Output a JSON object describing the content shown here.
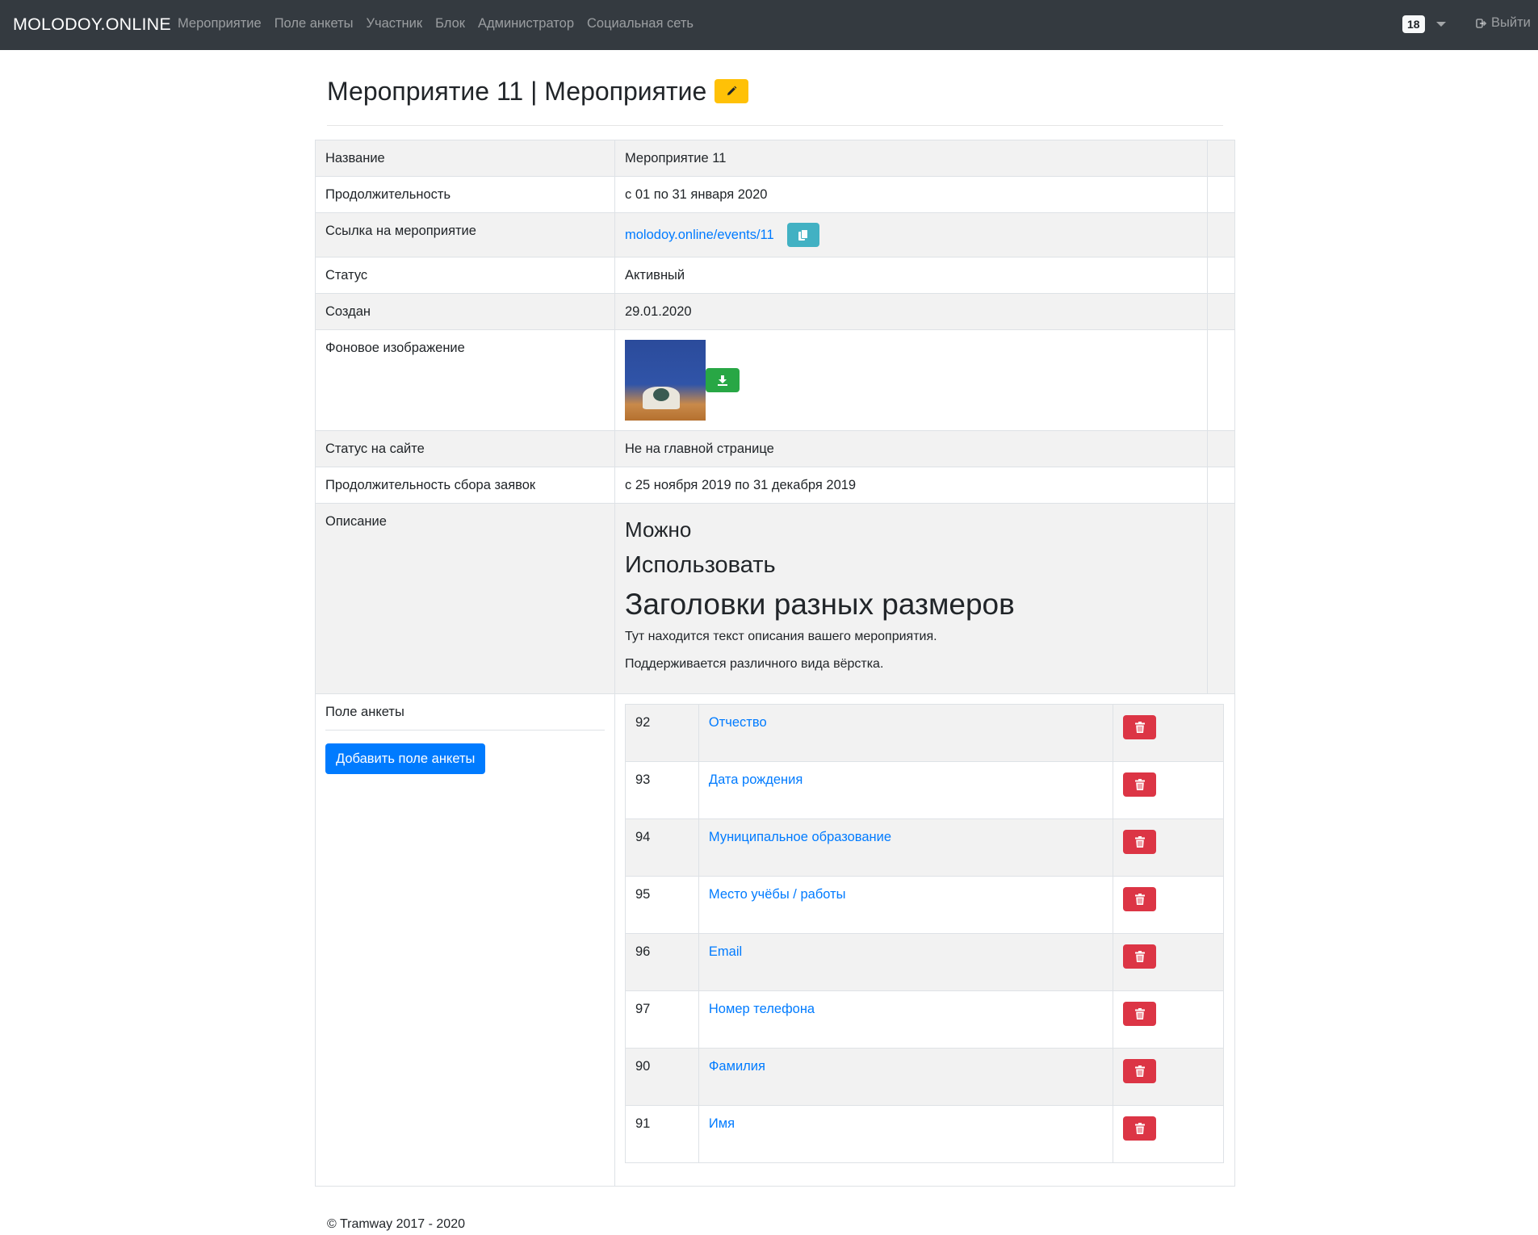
{
  "navbar": {
    "brand": "MOLODOY.ONLINE",
    "links": [
      "Мероприятие",
      "Поле анкеты",
      "Участник",
      "Блок",
      "Администратор",
      "Социальная сеть"
    ],
    "badge": "18",
    "logout": "Выйти"
  },
  "header": {
    "title": "Мероприятие 11 | Мероприятие",
    "edit_icon": "pencil-icon"
  },
  "details": {
    "name_label": "Название",
    "name_value": "Мероприятие 11",
    "duration_label": "Продолжительность",
    "duration_value": "с 01 по 31 января 2020",
    "link_label": "Ссылка на мероприятие",
    "link_value": "molodoy.online/events/11",
    "status_label": "Статус",
    "status_value": "Активный",
    "created_label": "Создан",
    "created_value": "29.01.2020",
    "bg_label": "Фоновое изображение",
    "site_status_label": "Статус на сайте",
    "site_status_value": "Не на главной странице",
    "apply_duration_label": "Продолжительность сбора заявок",
    "apply_duration_value": "с 25 ноября 2019 по 31 декабря 2019",
    "desc_label": "Описание",
    "desc_h4": "Можно",
    "desc_h3": "Использовать",
    "desc_h2": "Заголовки разных размеров",
    "desc_p1": "Тут находится текст описания вашего мероприятия.",
    "desc_p2": "Поддерживается различного вида вёрстка."
  },
  "form_fields": {
    "label": "Поле анкеты",
    "add_button": "Добавить поле анкеты",
    "rows": [
      {
        "id": "92",
        "name": "Отчество"
      },
      {
        "id": "93",
        "name": "Дата рождения"
      },
      {
        "id": "94",
        "name": "Муниципальное образование"
      },
      {
        "id": "95",
        "name": "Место учёбы / работы"
      },
      {
        "id": "96",
        "name": "Email"
      },
      {
        "id": "97",
        "name": "Номер телефона"
      },
      {
        "id": "90",
        "name": "Фамилия"
      },
      {
        "id": "91",
        "name": "Имя"
      }
    ]
  },
  "footer": {
    "copyright": "© Tramway 2017 - 2020"
  },
  "colors": {
    "navbar": "#343a40",
    "primary": "#007bff",
    "warning": "#ffc107",
    "info": "#17a2b8",
    "success": "#28a745",
    "danger": "#dc3545"
  }
}
